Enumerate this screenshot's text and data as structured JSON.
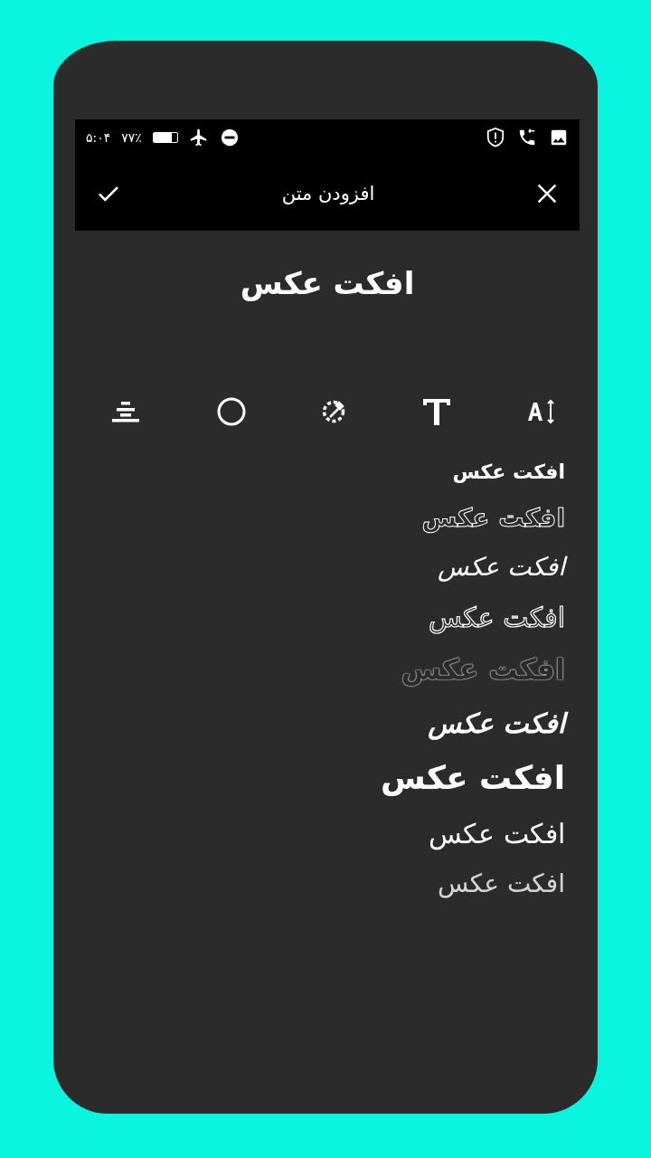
{
  "status_bar": {
    "time": "۵:۰۴",
    "battery_percent": "۷۷٪",
    "battery": {
      "level": 0.77
    }
  },
  "toolbar": {
    "title": "افزودن متن"
  },
  "preview": {
    "text": "افکت عکس"
  },
  "tools": [
    {
      "kind": "align"
    },
    {
      "kind": "shape"
    },
    {
      "kind": "color"
    },
    {
      "kind": "font"
    },
    {
      "kind": "size"
    }
  ],
  "fonts": [
    {
      "label": "افکت عکس",
      "kind": "blocky"
    },
    {
      "label": "افکت عکس",
      "kind": "dotted"
    },
    {
      "label": "افکت عکس",
      "kind": "script"
    },
    {
      "label": "افکت عکس",
      "kind": "outline"
    },
    {
      "label": "افکت عکس",
      "kind": "fuzzy"
    },
    {
      "label": "افکت عکس",
      "kind": "brush"
    },
    {
      "label": "افکت عکس",
      "kind": "bold"
    },
    {
      "label": "افکت عکس",
      "kind": "serif"
    },
    {
      "label": "افکت عکس",
      "kind": "sketch"
    }
  ]
}
